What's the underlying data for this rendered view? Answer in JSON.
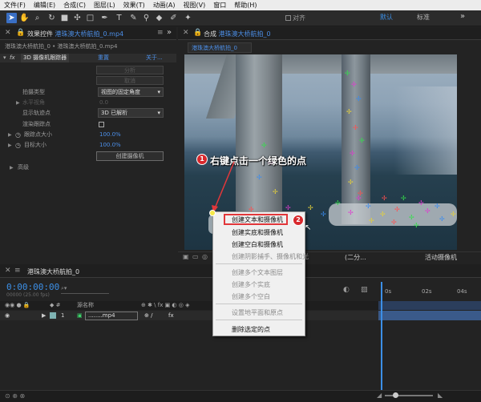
{
  "menu": [
    "文件(F)",
    "编辑(E)",
    "合成(C)",
    "图层(L)",
    "效果(T)",
    "动画(A)",
    "视图(V)",
    "窗口",
    "帮助(H)"
  ],
  "toolbar": {
    "align_label": "对齐",
    "workspace_default": "默认",
    "workspace_standard": "标准",
    "more": "»"
  },
  "effect_panel": {
    "tab_prefix": "效果控件",
    "tab_file": "港珠澳大桥航拍_0.mp4",
    "breadcrumb": "港珠澳大桥航拍_0 • 港珠澳大桥航拍_0.mp4",
    "effect_name": "3D 摄像机跟踪器",
    "reset": "重置",
    "about": "关于...",
    "analyze": "分析",
    "cancel": "取消",
    "shot_type_label": "拍摄类型",
    "shot_type_value": "视图的固定角度",
    "fov_label": "水平视角",
    "fov_value": "0.0",
    "show_points_label": "显示轨迹点",
    "show_points_value": "3D 已解析",
    "render_ground_label": "渲染跟踪点",
    "track_point_size_label": "跟踪点大小",
    "track_point_size_value": "100.0%",
    "target_size_label": "目标大小",
    "target_size_value": "100.0%",
    "create_camera": "创建摄像机",
    "advanced": "高级"
  },
  "comp_panel": {
    "tab_prefix": "合成",
    "tab_name": "港珠澳大桥航拍_0",
    "sub_tab": "港珠澳大桥航拍_0",
    "view_mode": "(二分...",
    "camera": "活动摄像机"
  },
  "timeline": {
    "tab_name": "港珠澳大桥航拍_0",
    "timecode": "0:00:00:00",
    "fps": "00000 (25.00 fps)",
    "source_name_header": "源名称",
    "layer_index": "1",
    "layer_name": "........mp4",
    "ruler": [
      "0s",
      "02s",
      "04s"
    ]
  },
  "context_menu": {
    "items": [
      {
        "label": "创建文本和摄像机",
        "enabled": true
      },
      {
        "label": "创建实底和摄像机",
        "enabled": true
      },
      {
        "label": "创建空白和摄像机",
        "enabled": true
      },
      {
        "label": "创建阴影捕手、摄像机和光",
        "enabled": false
      },
      {
        "label": "创建多个文本图层",
        "enabled": false
      },
      {
        "label": "创建多个实底",
        "enabled": false
      },
      {
        "label": "创建多个空白",
        "enabled": false
      },
      {
        "label": "设置地平面和原点",
        "enabled": false
      },
      {
        "label": "删除选定的点",
        "enabled": true
      }
    ]
  },
  "annotations": {
    "step1": "1",
    "step1_text": "右键点击一个绿色的点",
    "step2": "2"
  },
  "colors": {
    "accent": "#3c8fe6",
    "highlight_border": "#e2373a",
    "badge": "#d8282c"
  }
}
